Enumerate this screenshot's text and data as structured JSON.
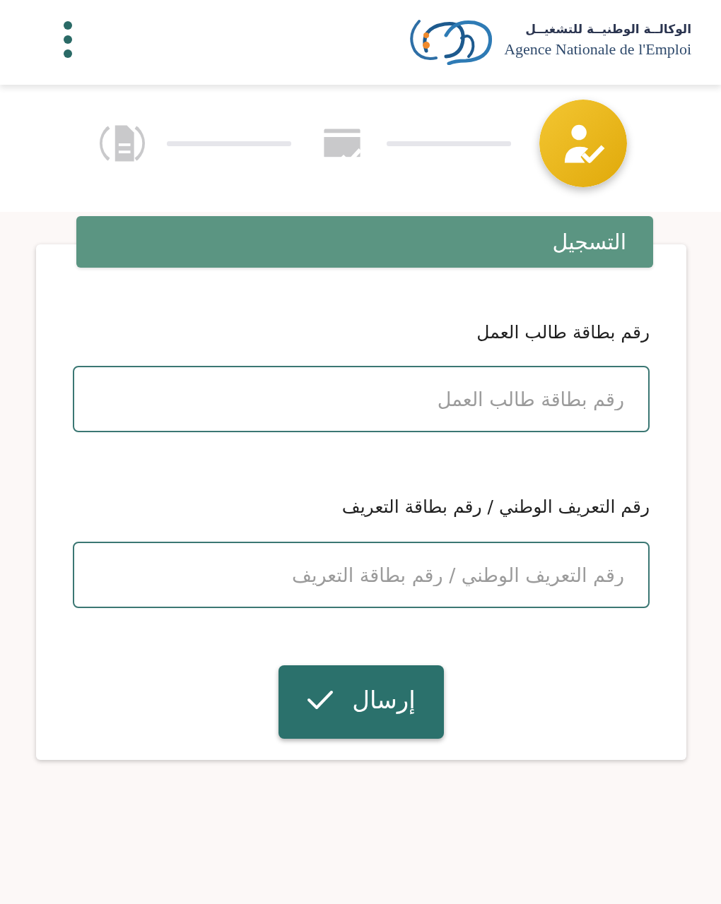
{
  "header": {
    "logo_arabic": "الوكالــة الوطنيــة للتشغيــل",
    "logo_french": "Agence Nationale de l'Emploi"
  },
  "steps": [
    {
      "kind": "person-check",
      "active": true
    },
    {
      "kind": "form-check",
      "active": false
    },
    {
      "kind": "document",
      "active": false
    }
  ],
  "form": {
    "title": "التسجيل",
    "fields": [
      {
        "label": "رقم بطاقة طالب العمل",
        "placeholder": "رقم بطاقة طالب العمل"
      },
      {
        "label": "رقم التعريف الوطني / رقم بطاقة التعريف",
        "placeholder": "رقم التعريف الوطني / رقم بطاقة التعريف"
      }
    ],
    "submit": {
      "label": "إرسال"
    }
  }
}
